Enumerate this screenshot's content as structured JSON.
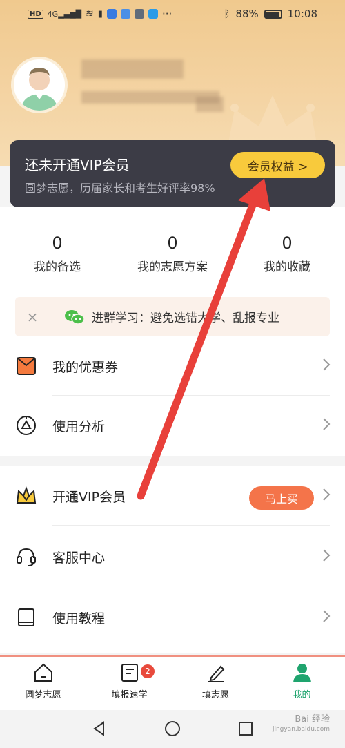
{
  "status_bar": {
    "left_icons": [
      "hd-icon",
      "4g-signal-icon",
      "wifi-icon",
      "alert-icon",
      "app-icon",
      "app-icon",
      "app-icon",
      "search-app-icon",
      "more-dots"
    ],
    "battery": "88%",
    "time": "10:08"
  },
  "profile": {
    "avatar_icon": "user-avatar"
  },
  "vip_card": {
    "title": "还未开通VIP会员",
    "subtitle": "圆梦志愿，历届家长和考生好评率98%",
    "button": "会员权益 >"
  },
  "stats": [
    {
      "value": "0",
      "label": "我的备选"
    },
    {
      "value": "0",
      "label": "我的志愿方案"
    },
    {
      "value": "0",
      "label": "我的收藏"
    }
  ],
  "banner": {
    "close": "×",
    "text": "进群学习：避免选错大学、乱报专业"
  },
  "menu1": [
    {
      "label": "我的优惠券",
      "icon": "coupon-icon"
    },
    {
      "label": "使用分析",
      "icon": "analysis-icon"
    }
  ],
  "menu2": [
    {
      "label": "开通VIP会员",
      "icon": "vip-crown-icon",
      "button": "马上买"
    },
    {
      "label": "客服中心",
      "icon": "headset-icon"
    },
    {
      "label": "使用教程",
      "icon": "book-icon"
    }
  ],
  "tabs": [
    {
      "label": "圆梦志愿",
      "icon": "home-icon"
    },
    {
      "label": "填报速学",
      "icon": "document-icon",
      "badge": "2"
    },
    {
      "label": "填志愿",
      "icon": "pen-icon"
    },
    {
      "label": "我的",
      "icon": "person-icon",
      "active": true
    }
  ],
  "watermark": {
    "main": "Bai 经验",
    "sub": "jingyan.baidu.com"
  },
  "colors": {
    "accent_green": "#1fa46e",
    "vip_gold": "#f8ca3c",
    "buy_orange": "#f4744a",
    "arrow_red": "#e8403a"
  }
}
